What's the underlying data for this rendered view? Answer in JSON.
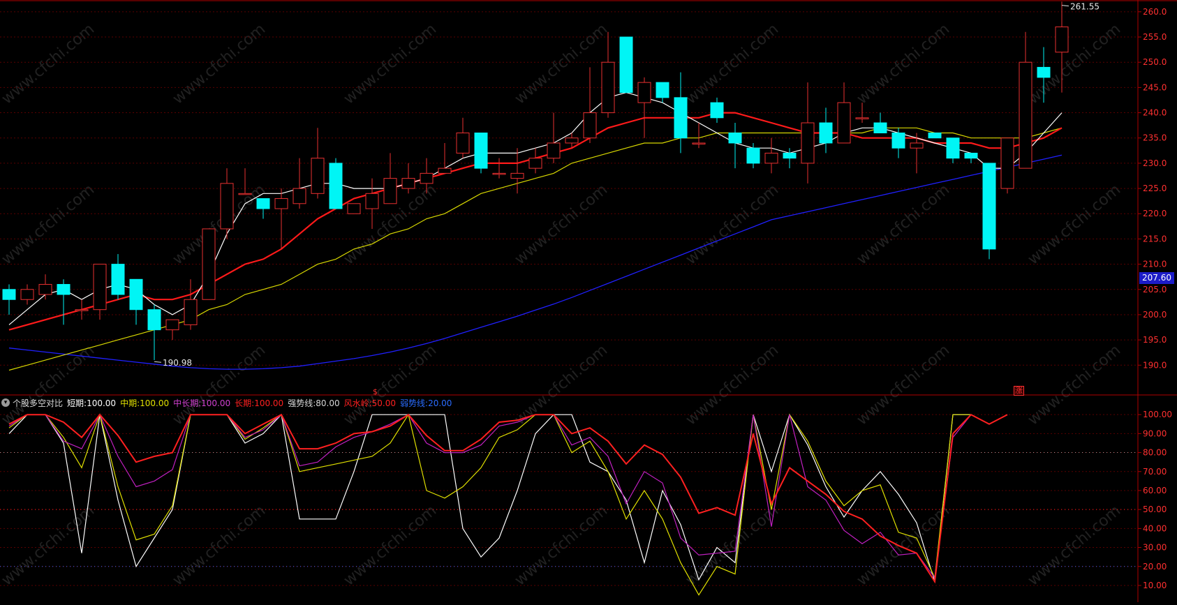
{
  "watermark_text": "www.cfchi.com",
  "colors": {
    "background": "#000000",
    "grid": "#5a0000",
    "axis": "#b00000",
    "axis_text": "#ff3030",
    "candle_up": "#e83030",
    "candle_down": "#00f5f5",
    "ma_short": "#ffffff",
    "ma_mid": "#ff1a1a",
    "ma_long": "#d8d800",
    "ma_longest": "#2020ff",
    "ind_short": "#ffffff",
    "ind_mid": "#e0e000",
    "ind_midlong": "#c020c0",
    "ind_long": "#ff2020",
    "price_tag_bg": "#1c1cc8"
  },
  "indicator_header": {
    "collapse_icon": "chevron-down",
    "title": "个股多空对比",
    "items": [
      {
        "label": "短期:",
        "value": "100.00",
        "color": "#ffffff"
      },
      {
        "label": "中期:",
        "value": "100.00",
        "color": "#e0e000"
      },
      {
        "label": "中长期:",
        "value": "100.00",
        "color": "#d040d0"
      },
      {
        "label": "长期:",
        "value": "100.00",
        "color": "#ff2020"
      },
      {
        "label": "强势线:",
        "value": "80.00",
        "color": "#d8d8d8"
      },
      {
        "label": "风水岭:",
        "value": "50.00",
        "color": "#ff2020"
      },
      {
        "label": "弱势线:",
        "value": "20.00",
        "color": "#2a6cff"
      }
    ]
  },
  "current_price_label": "207.60",
  "markers": [
    {
      "text": "$"
    },
    {
      "text": "涨"
    }
  ],
  "chart_data": [
    {
      "type": "candlestick",
      "y_ticks": [
        "260.0",
        "255.0",
        "250.0",
        "245.0",
        "240.0",
        "235.0",
        "230.0",
        "225.0",
        "220.0",
        "215.0",
        "210.0",
        "205.0",
        "200.0",
        "195.0",
        "190.0"
      ],
      "ylim": [
        187,
        261.5
      ],
      "grid": true,
      "high_label": "261.55",
      "low_label": "190.98",
      "candles": [
        [
          205,
          203,
          206,
          200
        ],
        [
          203,
          205,
          206,
          202
        ],
        [
          204,
          206,
          208,
          203
        ],
        [
          206,
          204,
          207,
          198
        ],
        [
          201,
          201,
          203,
          199
        ],
        [
          201,
          210,
          210,
          199
        ],
        [
          210,
          204,
          212,
          203
        ],
        [
          207,
          201,
          207,
          198
        ],
        [
          201,
          197,
          202,
          191
        ],
        [
          197,
          199,
          199,
          195
        ],
        [
          198,
          203,
          207,
          197
        ],
        [
          203,
          217,
          217,
          203
        ],
        [
          217,
          226,
          229,
          215
        ],
        [
          224,
          224,
          229,
          224
        ],
        [
          223,
          221,
          223,
          219
        ],
        [
          221,
          223,
          225,
          213
        ],
        [
          222,
          225,
          231,
          221
        ],
        [
          224,
          231,
          237,
          223
        ],
        [
          230,
          221,
          231,
          221
        ],
        [
          220,
          222,
          222,
          220
        ],
        [
          221,
          224,
          227,
          217
        ],
        [
          222,
          227,
          232,
          222
        ],
        [
          225,
          227,
          230,
          224
        ],
        [
          226,
          228,
          231,
          224
        ],
        [
          228,
          229,
          234,
          228
        ],
        [
          232,
          236,
          239,
          231
        ],
        [
          236,
          229,
          236,
          228
        ],
        [
          228,
          228,
          231,
          227
        ],
        [
          227,
          228,
          233,
          224
        ],
        [
          229,
          231,
          233,
          228
        ],
        [
          231,
          234,
          240,
          230
        ],
        [
          234,
          235,
          236,
          233
        ],
        [
          235,
          240,
          249,
          234
        ],
        [
          240,
          250,
          256,
          239
        ],
        [
          255,
          244,
          255,
          244
        ],
        [
          242,
          246,
          247,
          235
        ],
        [
          246,
          243,
          246,
          242
        ],
        [
          243,
          235,
          248,
          232
        ],
        [
          234,
          234,
          238,
          233
        ],
        [
          242,
          239,
          243,
          238
        ],
        [
          236,
          234,
          238,
          229
        ],
        [
          233,
          230,
          234,
          229
        ],
        [
          230,
          232,
          235,
          228
        ],
        [
          232,
          231,
          233,
          229
        ],
        [
          230,
          238,
          246,
          226
        ],
        [
          238,
          234,
          241,
          232
        ],
        [
          234,
          242,
          246,
          234
        ],
        [
          239,
          239,
          242,
          238
        ],
        [
          238,
          236,
          240,
          236
        ],
        [
          236,
          233,
          237,
          231
        ],
        [
          233,
          234,
          236,
          228
        ],
        [
          236,
          235,
          236,
          235
        ],
        [
          235,
          231,
          235,
          230
        ],
        [
          232,
          231,
          232,
          230
        ],
        [
          230,
          213,
          230,
          211
        ],
        [
          225,
          235,
          235,
          224
        ],
        [
          229,
          250,
          256,
          229
        ],
        [
          249,
          247,
          253,
          242
        ],
        [
          252,
          257,
          262,
          244
        ]
      ],
      "ma_short": [
        198,
        201,
        204,
        205,
        203,
        205,
        206,
        205,
        202,
        200,
        202,
        208,
        216,
        222,
        224,
        224,
        225,
        226,
        226,
        225,
        225,
        225,
        226,
        227,
        229,
        231,
        232,
        232,
        232,
        233,
        234,
        236,
        240,
        243,
        244,
        243,
        242,
        240,
        238,
        236,
        234,
        233,
        233,
        232,
        233,
        234,
        236,
        237,
        237,
        236,
        235,
        234,
        233,
        232,
        229,
        229,
        232,
        236,
        240
      ],
      "ma_mid": [
        197,
        198,
        199,
        200,
        201,
        202,
        203,
        204,
        203,
        203,
        204,
        206,
        208,
        210,
        211,
        213,
        216,
        219,
        221,
        223,
        224,
        225,
        226,
        227,
        228,
        229,
        230,
        230,
        230,
        231,
        232,
        233,
        235,
        237,
        238,
        239,
        239,
        239,
        239,
        240,
        240,
        239,
        238,
        237,
        236,
        236,
        236,
        235,
        235,
        235,
        235,
        234,
        234,
        234,
        233,
        233,
        234,
        235,
        237
      ],
      "ma_long": [
        189,
        190,
        191,
        192,
        193,
        194,
        195,
        196,
        197,
        198,
        199,
        201,
        202,
        204,
        205,
        206,
        208,
        210,
        211,
        213,
        214,
        216,
        217,
        219,
        220,
        222,
        224,
        225,
        226,
        227,
        228,
        230,
        231,
        232,
        233,
        234,
        234,
        235,
        235,
        236,
        236,
        236,
        236,
        236,
        236,
        236,
        236,
        236,
        237,
        237,
        237,
        236,
        236,
        235,
        235,
        235,
        235,
        236,
        237
      ],
      "ma_longest": [
        193.4,
        193,
        192.6,
        192.2,
        191.8,
        191.4,
        191,
        190.6,
        190.2,
        189.8,
        189.5,
        189.3,
        189.2,
        189.2,
        189.3,
        189.5,
        189.8,
        190.3,
        190.8,
        191.3,
        191.9,
        192.6,
        193.4,
        194.3,
        195.3,
        196.4,
        197.5,
        198.6,
        199.7,
        200.9,
        202.1,
        203.4,
        204.8,
        206.2,
        207.6,
        209,
        210.4,
        211.8,
        213.2,
        214.6,
        216,
        217.4,
        218.8,
        219.6,
        220.4,
        221.2,
        222,
        222.8,
        223.6,
        224.4,
        225.2,
        226,
        226.8,
        227.6,
        228.4,
        229.2,
        230,
        230.8,
        231.6
      ]
    },
    {
      "type": "line",
      "y_ticks": [
        "100.00",
        "90.00",
        "80.00",
        "70.00",
        "60.00",
        "50.00",
        "40.00",
        "30.00",
        "20.00",
        "10.00"
      ],
      "ylim": [
        3,
        103
      ],
      "grid": true,
      "series": [
        {
          "name": "短期",
          "values": [
            90,
            100,
            100,
            85,
            27,
            100,
            55,
            20,
            35,
            50,
            100,
            100,
            100,
            85,
            90,
            100,
            45,
            45,
            45,
            70,
            100,
            100,
            100,
            100,
            100,
            40,
            25,
            35,
            60,
            90,
            100,
            100,
            75,
            70,
            55,
            22,
            60,
            42,
            13,
            30,
            22,
            100,
            70,
            100,
            84,
            62,
            46,
            60,
            70,
            58,
            43,
            12,
            100,
            100
          ]
        },
        {
          "name": "中期",
          "values": [
            93,
            100,
            100,
            88,
            72,
            100,
            62,
            34,
            37,
            52,
            100,
            100,
            100,
            87,
            93,
            100,
            70,
            72,
            74,
            76,
            78,
            85,
            100,
            60,
            56,
            62,
            72,
            88,
            92,
            100,
            100,
            80,
            86,
            70,
            45,
            60,
            45,
            22,
            5,
            20,
            16,
            100,
            50,
            100,
            86,
            65,
            52,
            60,
            63,
            38,
            35,
            14,
            100,
            100
          ]
        },
        {
          "name": "中长期",
          "values": [
            94,
            100,
            100,
            86,
            82,
            100,
            78,
            62,
            65,
            71,
            100,
            100,
            100,
            88,
            92,
            100,
            73,
            75,
            83,
            88,
            91,
            95,
            100,
            85,
            80,
            80,
            84,
            94,
            96,
            100,
            100,
            84,
            88,
            78,
            53,
            70,
            64,
            35,
            26,
            27,
            28,
            100,
            41,
            100,
            62,
            55,
            39,
            32,
            38,
            26,
            27,
            14,
            88,
            100
          ]
        },
        {
          "name": "长期",
          "values": [
            95,
            100,
            100,
            96,
            88,
            100,
            89,
            75,
            78,
            80,
            100,
            100,
            100,
            90,
            95,
            100,
            82,
            82,
            85,
            90,
            91,
            94,
            100,
            89,
            81,
            81,
            87,
            96,
            97,
            100,
            100,
            90,
            93,
            86,
            74,
            84,
            79,
            67,
            48,
            51,
            47,
            90,
            53,
            72,
            65,
            58,
            49,
            45,
            36,
            31,
            27,
            12,
            90,
            100,
            95,
            100
          ]
        }
      ],
      "reference_lines": [
        80,
        50,
        20
      ]
    }
  ]
}
